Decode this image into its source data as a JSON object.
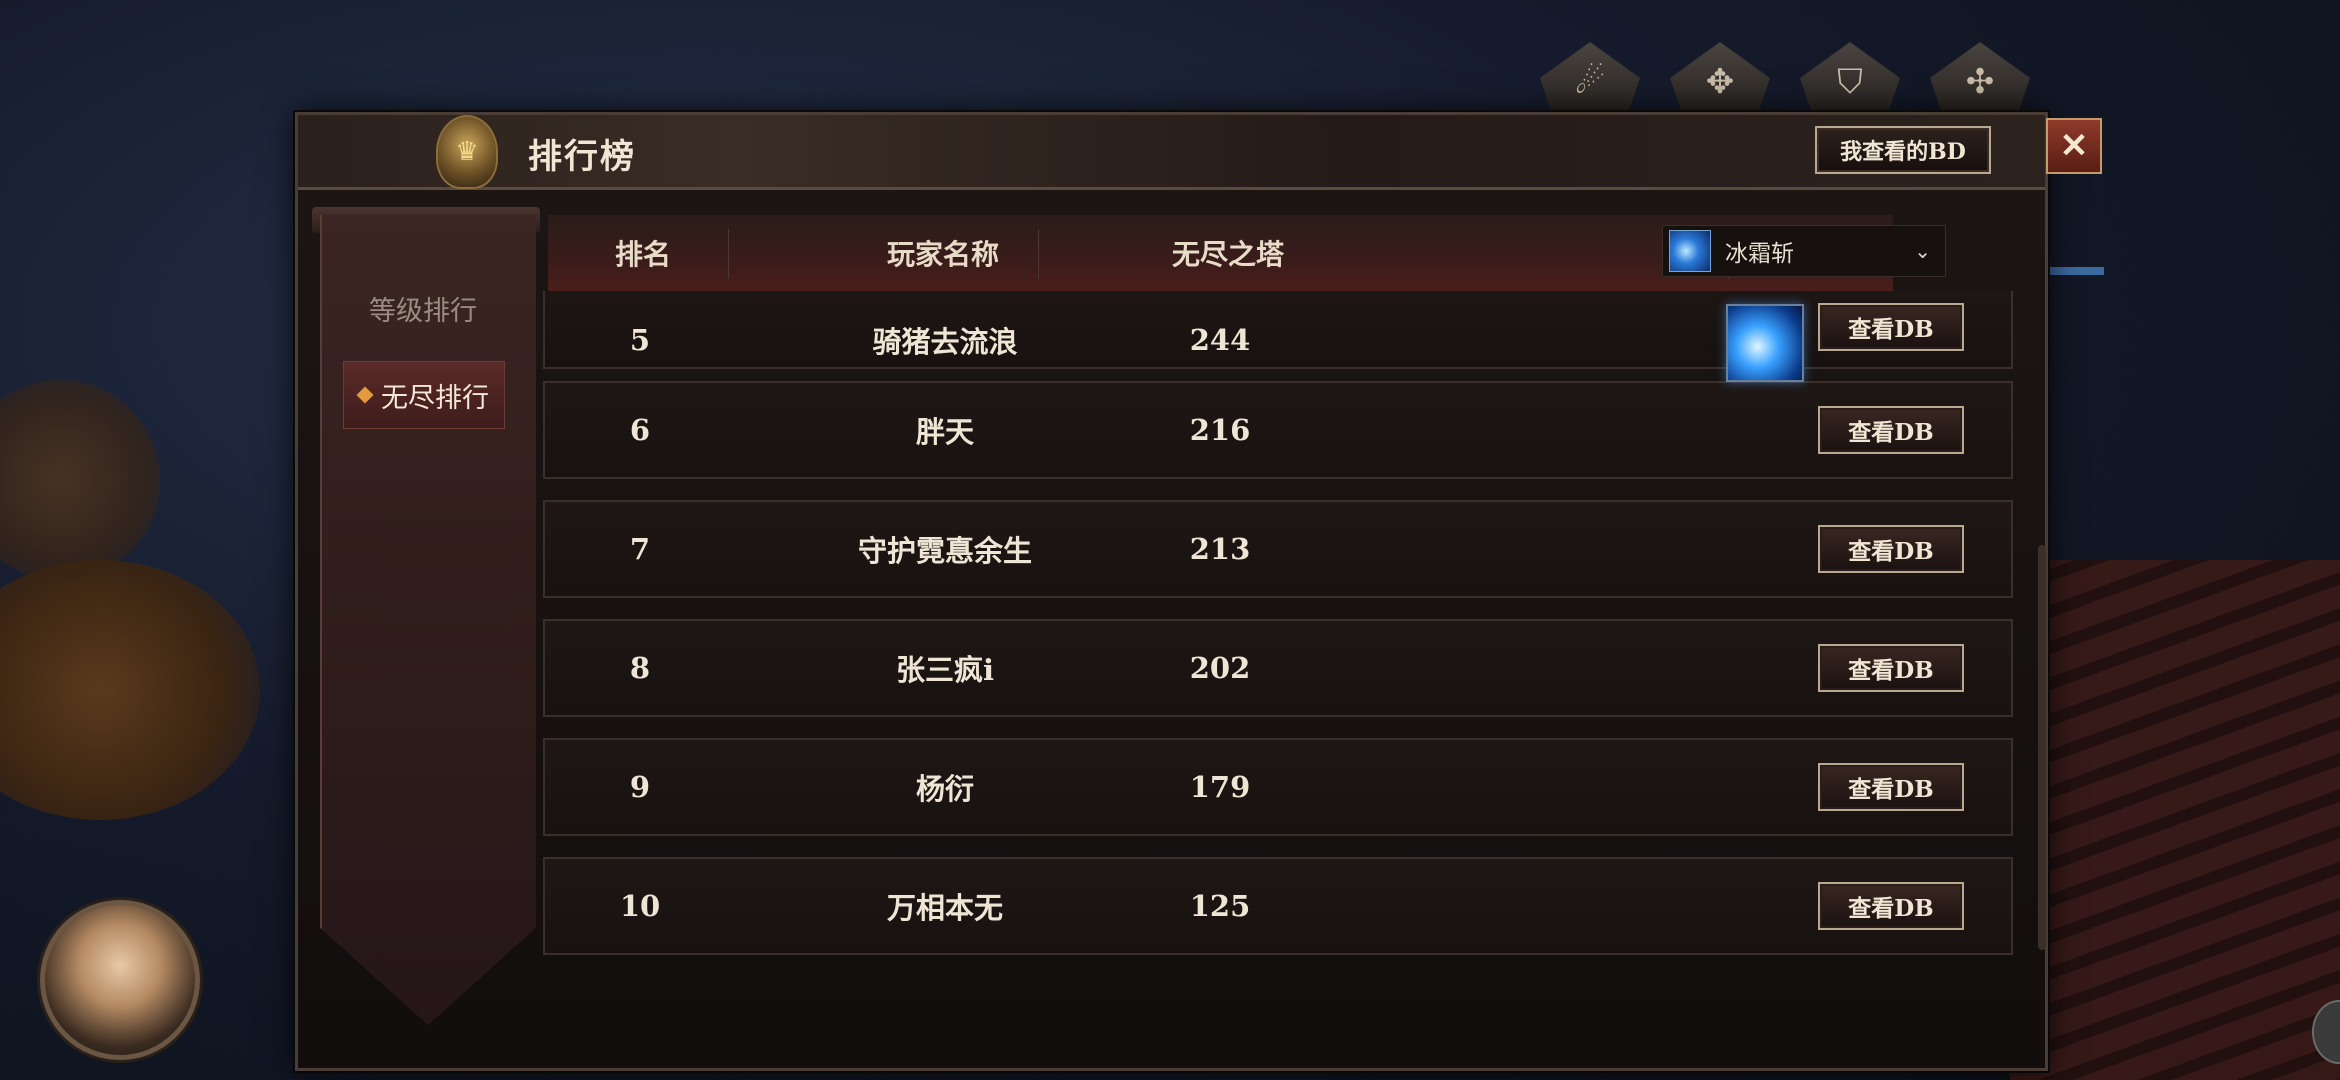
{
  "header": {
    "title": "排行榜",
    "bd_button_label": "我查看的BD",
    "close_label": "✕"
  },
  "top_icons": [
    "swirl-icon",
    "compass-icon",
    "bag-icon",
    "map-icon"
  ],
  "sidebar": {
    "items": [
      {
        "label": "等级排行",
        "active": false
      },
      {
        "label": "无尽排行",
        "active": true
      }
    ]
  },
  "table": {
    "columns": [
      "排名",
      "玩家名称",
      "无尽之塔"
    ],
    "skill_filter": {
      "selected": "冰霜斩"
    },
    "rows": [
      {
        "rank": "5",
        "name": "骑猪去流浪",
        "score": "244",
        "button": "查看DB"
      },
      {
        "rank": "6",
        "name": "胖天",
        "score": "216",
        "button": "查看DB"
      },
      {
        "rank": "7",
        "name": "守护霓惪余生",
        "score": "213",
        "button": "查看DB"
      },
      {
        "rank": "8",
        "name": "张三疯i",
        "score": "202",
        "button": "查看DB"
      },
      {
        "rank": "9",
        "name": "杨衍",
        "score": "179",
        "button": "查看DB"
      },
      {
        "rank": "10",
        "name": "万相本无",
        "score": "125",
        "button": "查看DB"
      }
    ]
  },
  "colors": {
    "accent_gold": "#e39a3e",
    "active_tab": "#5a2a28",
    "close_red": "#8e3a2a"
  }
}
